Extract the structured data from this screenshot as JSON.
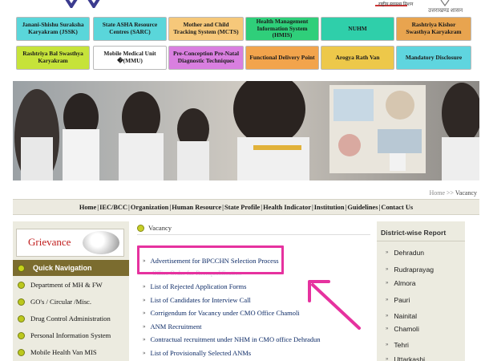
{
  "header": {
    "emblem_text": "राष्ट्रीय स्वास्थ्य मिशन",
    "govt_text": "उत्तराखण्ड शासन"
  },
  "programs": {
    "row1": [
      {
        "label": "Janani-Shishu Suraksha Karyakram (JSSK)",
        "color": "#5ad6da"
      },
      {
        "label": "State ASHA Resource Centres (SARC)",
        "color": "#5ad6da"
      },
      {
        "label": "Mother and Child Tracking System (MCTS)",
        "color": "#f6c87a"
      },
      {
        "label": "Health Management Information System (HMIS)",
        "color": "#2fcf7a"
      },
      {
        "label": "NUHM",
        "color": "#2fcfaa"
      },
      {
        "label": "Rashtriya Kishor Swasthya Karyakram",
        "color": "#e8a44f"
      }
    ],
    "row2": [
      {
        "label": "Rashtriya Bal Swasthya Karyakram",
        "color": "#c6e33a"
      },
      {
        "label": "Mobile Medical Unit �(MMU)",
        "color": "#ffffff"
      },
      {
        "label": "Pre-Conception Pre-Natal Diagnostic Techniques",
        "color": "#d97fe0"
      },
      {
        "label": "Functional Delivery Point",
        "color": "#f2a44c"
      },
      {
        "label": "Arogya Rath Van",
        "color": "#edc84a"
      },
      {
        "label": "Mandatory Disclosure",
        "color": "#5fd5df"
      }
    ]
  },
  "breadcrumb": {
    "home": "Home",
    "sep": ">>",
    "current": "Vacancy"
  },
  "nav": [
    "Home",
    "IEC/BCC",
    "Organization",
    "Human Resource",
    "State Profile",
    "Health Indicator",
    "Institution",
    "Guidelines",
    "Contact Us"
  ],
  "nav_sep": "|",
  "grievance": {
    "label": "Grievance"
  },
  "quick_nav": {
    "title": "Quick Navigation",
    "items": [
      "Department of MH & FW",
      "GO's / Circular /Misc.",
      "Drug Control Administration",
      "Personal Information System",
      "Mobile Health Van MIS"
    ]
  },
  "vacancy": {
    "heading": "Vacancy",
    "items": [
      "Advertisement for BPCCHN Selection Process",
      "List of Rejected Application Forms",
      "List of Candidates for Interview Call",
      "Corrigendum for Vacancy under CMO Office Chamoli",
      "ANM Recruitment",
      "Contractual recruitment under NHM in CMO office Dehradun",
      "List of Provisionally Selected ANMs"
    ],
    "faded_text": "Office Order for Reenqualification"
  },
  "district": {
    "title": "District-wise Report",
    "items": [
      "Dehradun",
      "Rudraprayag",
      "Almora",
      "Pauri",
      "Nainital",
      "Chamoli",
      "Tehri",
      "Uttarkashi"
    ]
  },
  "colors": {
    "annotation": "#e6329f",
    "quick_nav_bg": "#7b6c2f",
    "sidebar_bg": "#ecebe0",
    "link": "#0c2a66"
  }
}
